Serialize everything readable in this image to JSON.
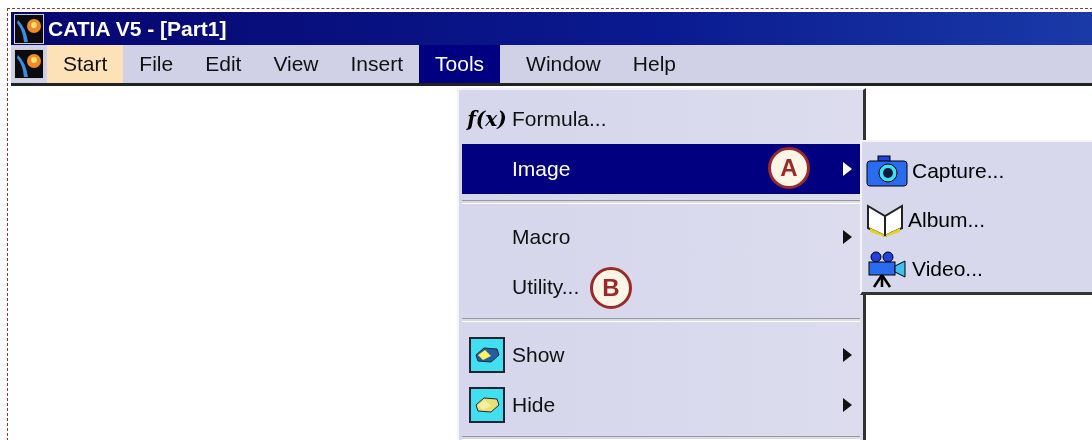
{
  "window": {
    "title": "CATIA V5 - [Part1]"
  },
  "menu_bar": [
    {
      "label": "Start",
      "hovered": true,
      "selected": false
    },
    {
      "label": "File",
      "hovered": false,
      "selected": false
    },
    {
      "label": "Edit",
      "hovered": false,
      "selected": false
    },
    {
      "label": "View",
      "hovered": false,
      "selected": false
    },
    {
      "label": "Insert",
      "hovered": false,
      "selected": false
    },
    {
      "label": "Tools",
      "hovered": false,
      "selected": true
    },
    {
      "label": "Window",
      "hovered": false,
      "selected": false
    },
    {
      "label": "Help",
      "hovered": false,
      "selected": false
    }
  ],
  "tools_menu": [
    {
      "kind": "formula",
      "label": "Formula...",
      "icon_glyph": "f(x)",
      "submenu": false,
      "selected": false
    },
    {
      "kind": "item",
      "label": "Image",
      "submenu": true,
      "selected": true,
      "callout": "A"
    },
    {
      "kind": "separator"
    },
    {
      "kind": "item",
      "label": "Macro",
      "submenu": true,
      "selected": false
    },
    {
      "kind": "item",
      "label": "Utility...",
      "submenu": false,
      "selected": false,
      "callout": "B"
    },
    {
      "kind": "separator"
    },
    {
      "kind": "show",
      "label": "Show",
      "submenu": true,
      "selected": false
    },
    {
      "kind": "hide",
      "label": "Hide",
      "submenu": true,
      "selected": false
    },
    {
      "kind": "separator"
    }
  ],
  "image_submenu": [
    {
      "kind": "camera",
      "label": "Capture..."
    },
    {
      "kind": "album",
      "label": "Album..."
    },
    {
      "kind": "video",
      "label": "Video..."
    }
  ]
}
